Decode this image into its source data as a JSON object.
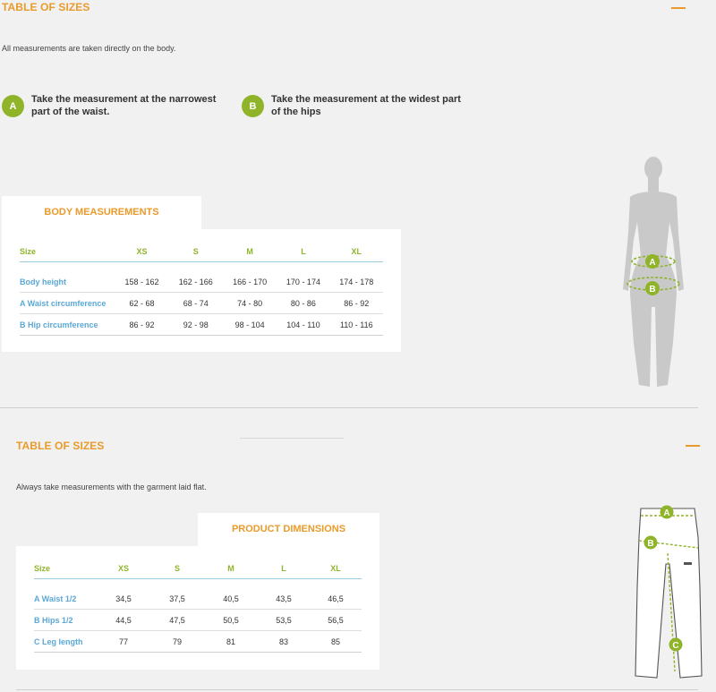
{
  "body_section": {
    "title": "TABLE OF SIZES",
    "description": "All measurements are taken directly on the body.",
    "steps": [
      {
        "badge": "A",
        "line1": "Take the measurement at the narrowest",
        "line2": "part of the waist."
      },
      {
        "badge": "B",
        "line1": "Take the measurement at the widest part",
        "line2": "of the hips"
      }
    ],
    "table_title": "BODY MEASUREMENTS",
    "table": {
      "headers": [
        "Size",
        "XS",
        "S",
        "M",
        "L",
        "XL"
      ],
      "rows": [
        {
          "label": "Body height",
          "values": [
            "158 - 162",
            "162 - 166",
            "166 - 170",
            "170 - 174",
            "174 - 178"
          ]
        },
        {
          "label": "A Waist circumference",
          "values": [
            "62 - 68",
            "68 - 74",
            "74 - 80",
            "80 - 86",
            "86 - 92"
          ]
        },
        {
          "label": "B Hip circumference",
          "values": [
            "86 - 92",
            "92 - 98",
            "98 - 104",
            "104 - 110",
            "110 - 116"
          ]
        }
      ]
    },
    "figure_labels": [
      "A",
      "B"
    ]
  },
  "product_section": {
    "title": "TABLE OF SIZES",
    "description": "Always take measurements with the garment laid flat.",
    "table_title": "PRODUCT DIMENSIONS",
    "table": {
      "headers": [
        "Size",
        "XS",
        "S",
        "M",
        "L",
        "XL"
      ],
      "rows": [
        {
          "label": "A Waist 1/2",
          "values": [
            "34,5",
            "37,5",
            "40,5",
            "43,5",
            "46,5"
          ]
        },
        {
          "label": "B Hips 1/2",
          "values": [
            "44,5",
            "47,5",
            "50,5",
            "53,5",
            "56,5"
          ]
        },
        {
          "label": "C Leg length",
          "values": [
            "77",
            "79",
            "81",
            "83",
            "85"
          ]
        }
      ]
    },
    "figure_labels": [
      "A",
      "B",
      "C"
    ]
  },
  "colors": {
    "accent": "#ea9a2a",
    "green": "#8fb42a",
    "blue": "#5ba8d6"
  }
}
